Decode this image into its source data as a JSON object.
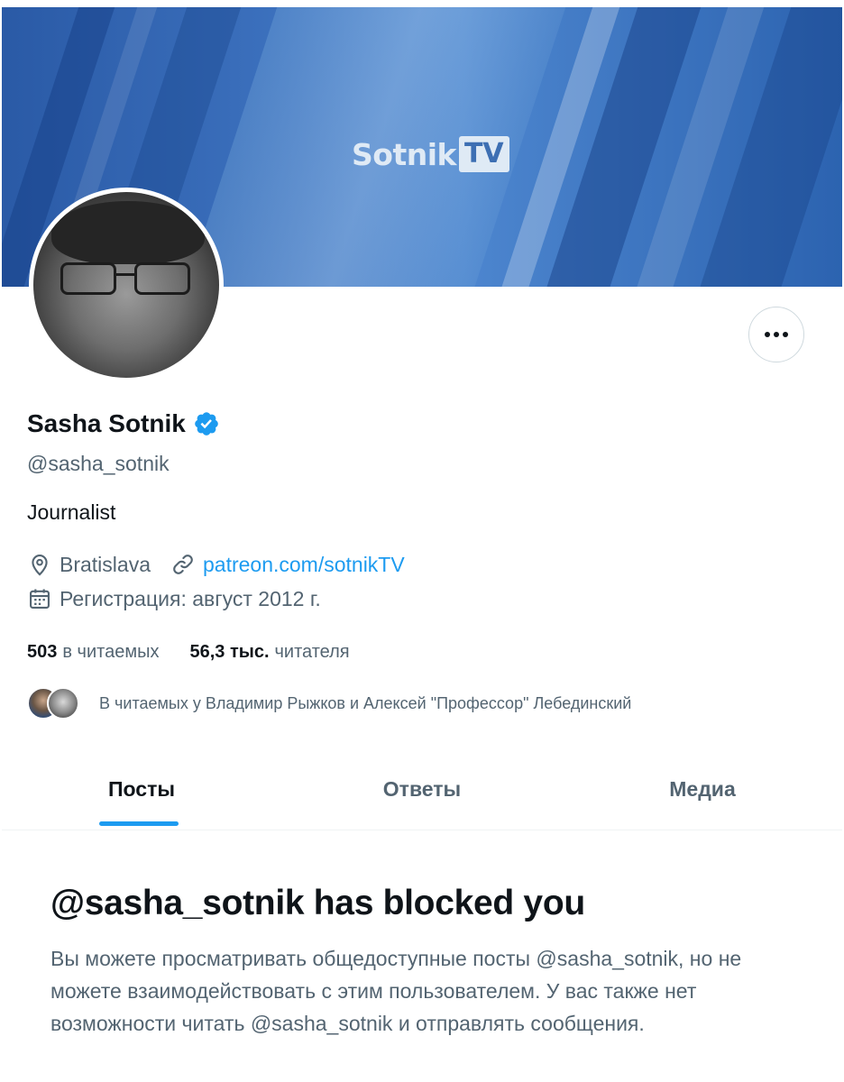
{
  "banner": {
    "brand_word": "Sotnik",
    "brand_tv": "TV"
  },
  "profile": {
    "display_name": "Sasha Sotnik",
    "handle": "@sasha_sotnik",
    "bio": "Journalist",
    "location": "Bratislava",
    "website": "patreon.com/sotnikTV",
    "joined": "Регистрация: август 2012 г."
  },
  "stats": {
    "following_count": "503",
    "following_label": "в читаемых",
    "followers_count": "56,3 тыс.",
    "followers_label": "читателя"
  },
  "followed_by": "В читаемых у Владимир Рыжков и Алексей \"Профессор\" Лебединский",
  "tabs": [
    {
      "label": "Посты",
      "active": true
    },
    {
      "label": "Ответы",
      "active": false
    },
    {
      "label": "Медиа",
      "active": false
    }
  ],
  "blocked": {
    "title": "@sasha_sotnik has blocked you",
    "text": "Вы можете просматривать общедоступные посты @sasha_sotnik, но не можете взаимодействовать с этим пользователем. У вас также нет возможности читать @sasha_sotnik и отправлять сообщения."
  },
  "icons": [
    "verified-badge-icon",
    "location-pin-icon",
    "link-icon",
    "calendar-icon",
    "more-options-icon"
  ],
  "colors": {
    "accent": "#1d9bf0",
    "text_primary": "#0f1419",
    "text_secondary": "#536471"
  }
}
